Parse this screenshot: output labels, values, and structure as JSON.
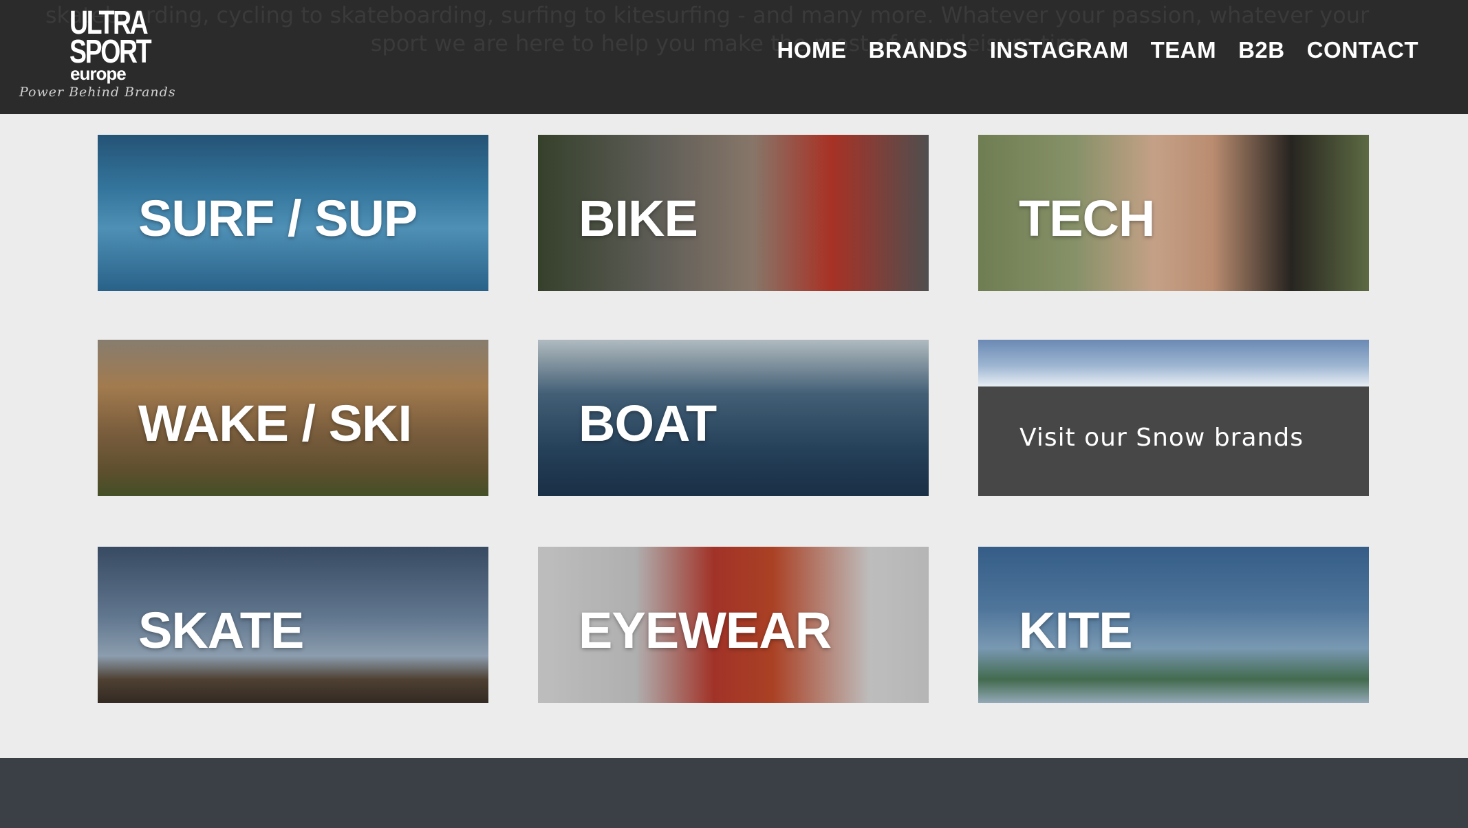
{
  "intro": {
    "line1": "skateboarding, cycling to skateboarding, surfing to kitesurfing - and many more. Whatever your passion, whatever your",
    "line2": "sport we are here to help you make the most of your leisure time."
  },
  "logo": {
    "line1": "ULTRA",
    "line2": "SPORT",
    "line3": "europe",
    "tagline": "Power Behind Brands"
  },
  "nav": [
    "HOME",
    "BRANDS",
    "INSTAGRAM",
    "TEAM",
    "B2B",
    "CONTACT"
  ],
  "tiles": [
    {
      "label": "SURF / SUP"
    },
    {
      "label": "BIKE"
    },
    {
      "label": "TECH"
    },
    {
      "label": "WAKE / SKI"
    },
    {
      "label": "BOAT"
    },
    {
      "label": "Visit our Snow brands"
    },
    {
      "label": "SKATE"
    },
    {
      "label": "EYEWEAR"
    },
    {
      "label": "KITE"
    }
  ],
  "colors": {
    "header_bg": "#2b2b2b",
    "page_bg": "#ececec",
    "snow_panel_bg": "#474747",
    "footer_bg": "#3b4047"
  }
}
